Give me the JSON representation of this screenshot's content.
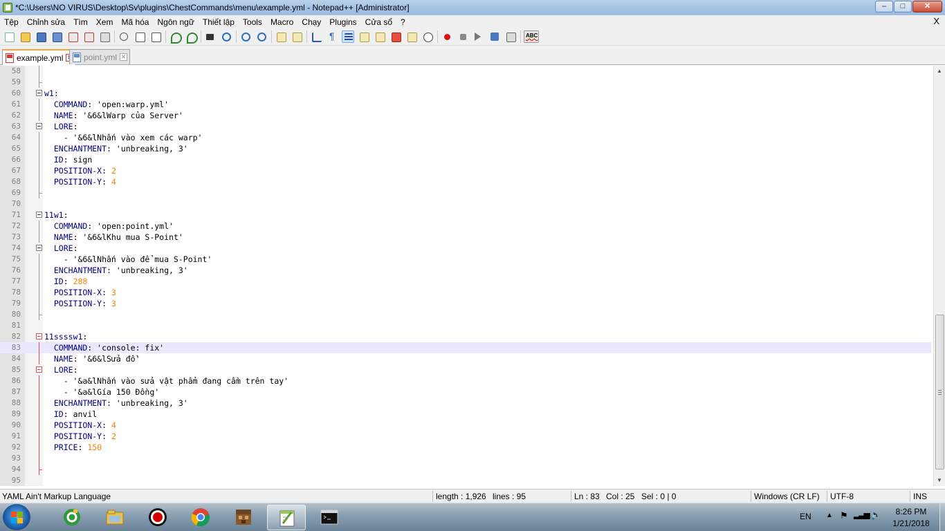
{
  "window": {
    "title": "*C:\\Users\\NO VIRUS\\Desktop\\Sv\\plugins\\ChestCommands\\menu\\example.yml - Notepad++ [Administrator]",
    "buttons": {
      "minimize": "‒",
      "maximize": "□",
      "close": "✕"
    }
  },
  "menu": {
    "items": [
      "Tệp",
      "Chỉnh sửa",
      "Tìm",
      "Xem",
      "Mã hóa",
      "Ngôn ngữ",
      "Thiết lập",
      "Tools",
      "Macro",
      "Chạy",
      "Plugins",
      "Cửa sổ",
      "?"
    ],
    "close": "X"
  },
  "tabs": [
    {
      "label": "example.yml",
      "active": true
    },
    {
      "label": "point.yml",
      "active": false
    }
  ],
  "editor": {
    "lines": [
      {
        "n": "58",
        "parts": []
      },
      {
        "n": "59",
        "parts": []
      },
      {
        "n": "60",
        "parts": [
          [
            "key",
            "w1"
          ],
          [
            "plain",
            ":"
          ]
        ]
      },
      {
        "n": "61",
        "parts": [
          [
            "plain",
            "  "
          ],
          [
            "key",
            "COMMAND"
          ],
          [
            "plain",
            ": 'open:warp.yml'"
          ]
        ]
      },
      {
        "n": "62",
        "parts": [
          [
            "plain",
            "  "
          ],
          [
            "key",
            "NAME"
          ],
          [
            "plain",
            ": '&6&lWarp của Server'"
          ]
        ]
      },
      {
        "n": "63",
        "parts": [
          [
            "plain",
            "  "
          ],
          [
            "key",
            "LORE"
          ],
          [
            "plain",
            ":"
          ]
        ]
      },
      {
        "n": "64",
        "parts": [
          [
            "plain",
            "    - '&6&lNhấn vào xem các warp'"
          ]
        ]
      },
      {
        "n": "65",
        "parts": [
          [
            "plain",
            "  "
          ],
          [
            "key",
            "ENCHANTMENT"
          ],
          [
            "plain",
            ": 'unbreaking, 3'"
          ]
        ]
      },
      {
        "n": "66",
        "parts": [
          [
            "plain",
            "  "
          ],
          [
            "key",
            "ID"
          ],
          [
            "plain",
            ": sign"
          ]
        ]
      },
      {
        "n": "67",
        "parts": [
          [
            "plain",
            "  "
          ],
          [
            "key",
            "POSITION-X"
          ],
          [
            "plain",
            ": "
          ],
          [
            "num",
            "2"
          ]
        ]
      },
      {
        "n": "68",
        "parts": [
          [
            "plain",
            "  "
          ],
          [
            "key",
            "POSITION-Y"
          ],
          [
            "plain",
            ": "
          ],
          [
            "num",
            "4"
          ]
        ]
      },
      {
        "n": "69",
        "parts": []
      },
      {
        "n": "70",
        "parts": []
      },
      {
        "n": "71",
        "parts": [
          [
            "key",
            "11w1"
          ],
          [
            "plain",
            ":"
          ]
        ]
      },
      {
        "n": "72",
        "parts": [
          [
            "plain",
            "  "
          ],
          [
            "key",
            "COMMAND"
          ],
          [
            "plain",
            ": 'open:point.yml'"
          ]
        ]
      },
      {
        "n": "73",
        "parts": [
          [
            "plain",
            "  "
          ],
          [
            "key",
            "NAME"
          ],
          [
            "plain",
            ": '&6&lKhu mua S-Point'"
          ]
        ]
      },
      {
        "n": "74",
        "parts": [
          [
            "plain",
            "  "
          ],
          [
            "key",
            "LORE"
          ],
          [
            "plain",
            ":"
          ]
        ]
      },
      {
        "n": "75",
        "parts": [
          [
            "plain",
            "    - '&6&lNhấn vào để mua S-Point'"
          ]
        ]
      },
      {
        "n": "76",
        "parts": [
          [
            "plain",
            "  "
          ],
          [
            "key",
            "ENCHANTMENT"
          ],
          [
            "plain",
            ": 'unbreaking, 3'"
          ]
        ]
      },
      {
        "n": "77",
        "parts": [
          [
            "plain",
            "  "
          ],
          [
            "key",
            "ID"
          ],
          [
            "plain",
            ": "
          ],
          [
            "num",
            "288"
          ]
        ]
      },
      {
        "n": "78",
        "parts": [
          [
            "plain",
            "  "
          ],
          [
            "key",
            "POSITION-X"
          ],
          [
            "plain",
            ": "
          ],
          [
            "num",
            "3"
          ]
        ]
      },
      {
        "n": "79",
        "parts": [
          [
            "plain",
            "  "
          ],
          [
            "key",
            "POSITION-Y"
          ],
          [
            "plain",
            ": "
          ],
          [
            "num",
            "3"
          ]
        ]
      },
      {
        "n": "80",
        "parts": []
      },
      {
        "n": "81",
        "parts": []
      },
      {
        "n": "82",
        "parts": [
          [
            "key",
            "11ssssw1"
          ],
          [
            "plain",
            ":"
          ]
        ]
      },
      {
        "n": "83",
        "parts": [
          [
            "plain",
            "  "
          ],
          [
            "key",
            "COMMAND"
          ],
          [
            "plain",
            ": 'console: fix'"
          ]
        ]
      },
      {
        "n": "84",
        "parts": [
          [
            "plain",
            "  "
          ],
          [
            "key",
            "NAME"
          ],
          [
            "plain",
            ": '&6&lSửa đồ'"
          ]
        ]
      },
      {
        "n": "85",
        "parts": [
          [
            "plain",
            "  "
          ],
          [
            "key",
            "LORE"
          ],
          [
            "plain",
            ":"
          ]
        ]
      },
      {
        "n": "86",
        "parts": [
          [
            "plain",
            "    - '&a&lNhấn vào sửa vật phẩm đang cầm trên tay'"
          ]
        ]
      },
      {
        "n": "87",
        "parts": [
          [
            "plain",
            "    - '&a&lGía 150 Đồng'"
          ]
        ]
      },
      {
        "n": "88",
        "parts": [
          [
            "plain",
            "  "
          ],
          [
            "key",
            "ENCHANTMENT"
          ],
          [
            "plain",
            ": 'unbreaking, 3'"
          ]
        ]
      },
      {
        "n": "89",
        "parts": [
          [
            "plain",
            "  "
          ],
          [
            "key",
            "ID"
          ],
          [
            "plain",
            ": anvil"
          ]
        ]
      },
      {
        "n": "90",
        "parts": [
          [
            "plain",
            "  "
          ],
          [
            "key",
            "POSITION-X"
          ],
          [
            "plain",
            ": "
          ],
          [
            "num",
            "4"
          ]
        ]
      },
      {
        "n": "91",
        "parts": [
          [
            "plain",
            "  "
          ],
          [
            "key",
            "POSITION-Y"
          ],
          [
            "plain",
            ": "
          ],
          [
            "num",
            "2"
          ]
        ]
      },
      {
        "n": "92",
        "parts": [
          [
            "plain",
            "  "
          ],
          [
            "key",
            "PRICE"
          ],
          [
            "plain",
            ": "
          ],
          [
            "num",
            "150"
          ]
        ]
      },
      {
        "n": "93",
        "parts": []
      },
      {
        "n": "94",
        "parts": []
      },
      {
        "n": "95",
        "parts": []
      }
    ],
    "current_line": "83",
    "colors": {
      "key": "#000080",
      "number": "#ff8000",
      "current_line_bg": "#e8e8ff",
      "fold_active": "#e05050"
    }
  },
  "statusbar": {
    "language": "YAML Ain't Markup Language",
    "length": "length : 1,926",
    "lines": "lines : 95",
    "ln": "Ln : 83",
    "col": "Col : 25",
    "sel": "Sel : 0 | 0",
    "eol": "Windows (CR LF)",
    "encoding": "UTF-8",
    "mode": "INS"
  },
  "taskbar": {
    "apps": [
      "coc-coc-icon",
      "file-explorer-icon",
      "recorder-icon",
      "chrome-icon",
      "minecraft-icon",
      "notepadpp-icon",
      "cmd-icon"
    ],
    "language": "EN",
    "time": "8:26 PM",
    "date": "1/21/2018"
  }
}
